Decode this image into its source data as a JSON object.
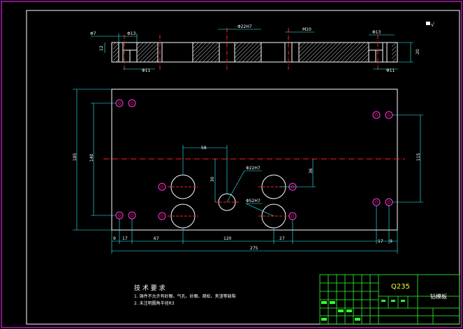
{
  "sheet": {
    "material": "Q235",
    "part_name": "钻模板",
    "roughness_symbol": "√"
  },
  "tech_requirements": {
    "title": "技 术 要 求",
    "items": [
      "1. 铸件不允许有砂眼、气孔、砂眼、疏松、夹渣等缺陷",
      "2. 未注明圆角半径R3"
    ]
  },
  "dims_top": {
    "d7": "Φ7",
    "d13_left": "Φ13",
    "d11_left": "Φ11",
    "d22h7": "Φ22H7",
    "m10": "M10",
    "d13_right": "Φ13",
    "d11_right": "Φ11",
    "h12": "12",
    "h20": "20"
  },
  "dims_plan": {
    "h185": "185",
    "h140": "140",
    "h115": "115",
    "w58": "58",
    "v30": "30",
    "v36": "36",
    "d22h7": "Φ22H7",
    "d52h7": "Φ52H7",
    "b9_left": "9",
    "b17_left": "17",
    "b67": "67",
    "b120": "120",
    "b27": "27",
    "b17_right": "17",
    "b9_right": "9",
    "total": "275"
  },
  "colors": {
    "line": "#ffffff",
    "center_line": "#ff2020",
    "dim": "#33ffff",
    "hatch": "#ffffff",
    "hole": "#ff33ff",
    "frame": "#ff33ff",
    "table": "#33ff33",
    "material": "#ffff33"
  }
}
